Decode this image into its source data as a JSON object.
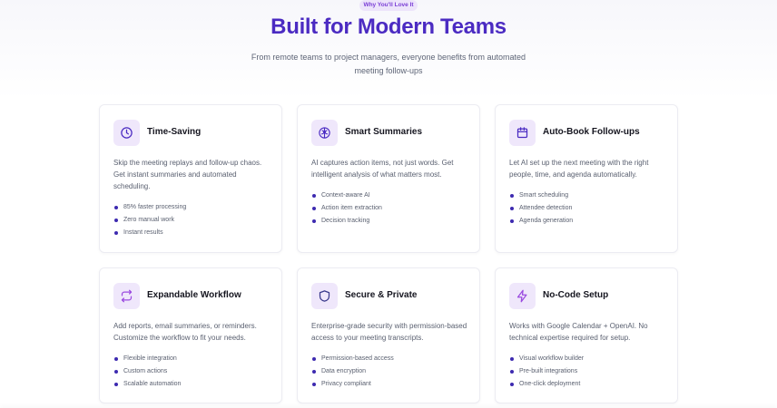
{
  "header": {
    "badge": "Why You'll Love It",
    "title": "Built for Modern Teams",
    "subtitle": "From remote teams to project managers, everyone benefits from automated meeting follow-ups"
  },
  "colors": {
    "accent": "#4b2bc2",
    "icon_bg": "#efe7fb",
    "bullet": "#3d2ab0"
  },
  "cards": [
    {
      "icon": "clock-icon",
      "title": "Time-Saving",
      "description": "Skip the meeting replays and follow-up chaos. Get instant summaries and automated scheduling.",
      "features": [
        "85% faster processing",
        "Zero manual work",
        "Instant results"
      ]
    },
    {
      "icon": "brain-icon",
      "title": "Smart Summaries",
      "description": "AI captures action items, not just words. Get intelligent analysis of what matters most.",
      "features": [
        "Context-aware AI",
        "Action item extraction",
        "Decision tracking"
      ]
    },
    {
      "icon": "calendar-icon",
      "title": "Auto-Book Follow-ups",
      "description": "Let AI set up the next meeting with the right people, time, and agenda automatically.",
      "features": [
        "Smart scheduling",
        "Attendee detection",
        "Agenda generation"
      ]
    },
    {
      "icon": "repeat-icon",
      "title": "Expandable Workflow",
      "description": "Add reports, email summaries, or reminders. Customize the workflow to fit your needs.",
      "features": [
        "Flexible integration",
        "Custom actions",
        "Scalable automation"
      ]
    },
    {
      "icon": "shield-icon",
      "title": "Secure & Private",
      "description": "Enterprise-grade security with permission-based access to your meeting transcripts.",
      "features": [
        "Permission-based access",
        "Data encryption",
        "Privacy compliant"
      ]
    },
    {
      "icon": "lightning-icon",
      "title": "No-Code Setup",
      "description": "Works with Google Calendar + OpenAI. No technical expertise required for setup.",
      "features": [
        "Visual workflow builder",
        "Pre-built integrations",
        "One-click deployment"
      ]
    }
  ]
}
